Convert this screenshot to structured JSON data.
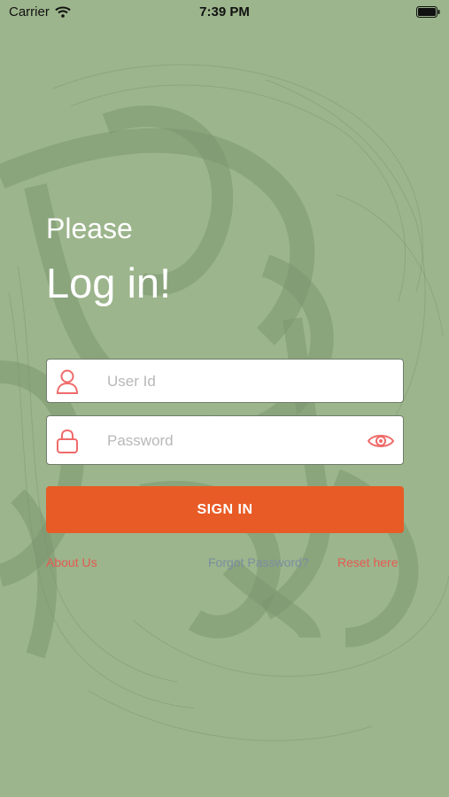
{
  "status_bar": {
    "carrier": "Carrier",
    "time": "7:39 PM"
  },
  "login": {
    "greeting": "Please",
    "heading": "Log in!",
    "user_id_placeholder": "User Id",
    "password_placeholder": "Password",
    "sign_in_label": "SIGN IN",
    "about_us_label": "About Us",
    "forgot_password_text": "Forgot Password?",
    "reset_label": "Reset here"
  },
  "colors": {
    "background": "#9cb58c",
    "accent_button": "#e85b26",
    "link": "#e45b52",
    "icon": "#ef6a6a"
  }
}
